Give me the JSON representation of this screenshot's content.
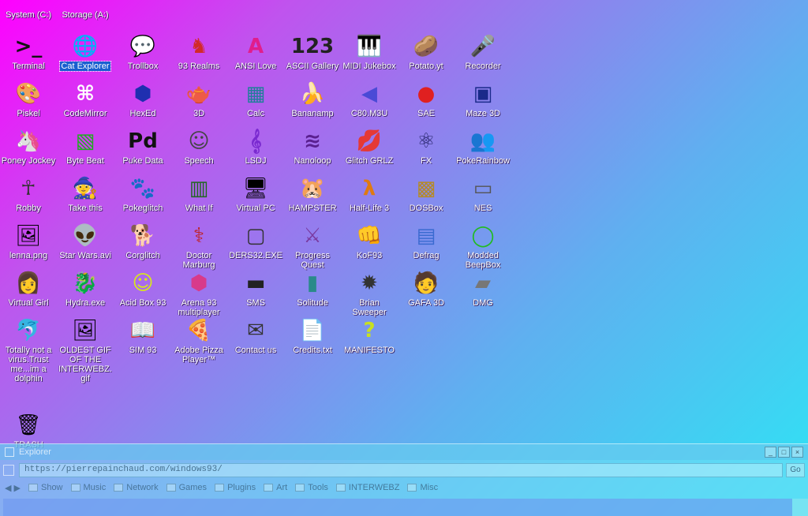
{
  "desktop": {
    "top_row": [
      {
        "label": "System (C:)",
        "icon": "drive-icon"
      },
      {
        "label": "Storage (A:)",
        "icon": "floppy-icon"
      }
    ],
    "rows": [
      [
        {
          "label": "Terminal",
          "glyph": ">_",
          "icon": "terminal-icon",
          "color": "#111111"
        },
        {
          "label": "Cat Explorer",
          "glyph": "🌐",
          "icon": "cat-globe-icon",
          "selected": true
        },
        {
          "label": "Trollbox",
          "glyph": "💬",
          "icon": "chat-bubble-icon"
        },
        {
          "label": "93 Realms",
          "glyph": "♞",
          "icon": "realms-icon",
          "color": "#d22a2a"
        },
        {
          "label": "ANSI Love",
          "glyph": "A",
          "icon": "ansi-icon",
          "color": "#e01e8c"
        },
        {
          "label": "ASCII Gallery",
          "glyph": "123",
          "icon": "ascii-icon",
          "color": "#222222"
        },
        {
          "label": "MIDI Jukebox",
          "glyph": "🎹",
          "icon": "keyboard-icon"
        },
        {
          "label": "Potato.yt",
          "glyph": "🥔",
          "icon": "potato-icon"
        },
        {
          "label": "Recorder",
          "glyph": "🎤",
          "icon": "microphone-icon"
        }
      ],
      [
        {
          "label": "Piskel",
          "glyph": "🎨",
          "icon": "palette-icon"
        },
        {
          "label": "CodeMirror",
          "glyph": "⌘",
          "icon": "codemirror-icon",
          "color": "#ffffff"
        },
        {
          "label": "HexEd",
          "glyph": "⬢",
          "icon": "hexed-cube-icon",
          "color": "#1f2fb0"
        },
        {
          "label": "3D",
          "glyph": "🫖",
          "icon": "teapot-icon"
        },
        {
          "label": "Calc",
          "glyph": "▦",
          "icon": "calculator-icon",
          "color": "#1f7f9a"
        },
        {
          "label": "Bananamp",
          "glyph": "🍌",
          "icon": "banana-icon"
        },
        {
          "label": "C80.M3U",
          "glyph": "◀",
          "icon": "playlist-icon",
          "color": "#4a4ad6"
        },
        {
          "label": "SAE",
          "glyph": "●",
          "icon": "amiga-ball-icon",
          "color": "#e02020"
        },
        {
          "label": "Maze 3D",
          "glyph": "▣",
          "icon": "maze-icon",
          "color": "#1a2a8a"
        }
      ],
      [
        {
          "label": "Poney Jockey",
          "glyph": "🦄",
          "icon": "pony-icon"
        },
        {
          "label": "Byte Beat",
          "glyph": "▧",
          "icon": "bytebeat-icon",
          "color": "#22aa22"
        },
        {
          "label": "Puke Data",
          "glyph": "Pd",
          "icon": "puredata-icon",
          "color": "#111111"
        },
        {
          "label": "Speech",
          "glyph": "☺",
          "icon": "speech-face-icon",
          "color": "#444444"
        },
        {
          "label": "LSDJ",
          "glyph": "𝄞",
          "icon": "lsdj-icon",
          "color": "#7a2ad0"
        },
        {
          "label": "Nanoloop",
          "glyph": "≋",
          "icon": "nanoloop-icon",
          "color": "#5a2090"
        },
        {
          "label": "Glitch GRLZ",
          "glyph": "💋",
          "icon": "lips-icon"
        },
        {
          "label": "FX",
          "glyph": "⚛",
          "icon": "atom-icon",
          "color": "#222266"
        },
        {
          "label": "PokeRainbow",
          "glyph": "👥",
          "icon": "pokerainbow-icon"
        }
      ],
      [
        {
          "label": "Robby",
          "glyph": "☥",
          "icon": "robby-stickman-icon",
          "color": "#333333"
        },
        {
          "label": "Take this",
          "glyph": "🧙",
          "icon": "take-this-icon"
        },
        {
          "label": "Pokeglitch",
          "glyph": "🐾",
          "icon": "pokeglitch-icon"
        },
        {
          "label": "What If",
          "glyph": "▥",
          "icon": "whatif-icon",
          "color": "#226622"
        },
        {
          "label": "Virtual PC",
          "glyph": "🖥",
          "icon": "virtual-pc-icon"
        },
        {
          "label": "HAMPSTER",
          "glyph": "🐹",
          "icon": "hamster-icon"
        },
        {
          "label": "Half-Life 3",
          "glyph": "λ",
          "icon": "half-life-icon",
          "color": "#e07a10"
        },
        {
          "label": "DOSBox",
          "glyph": "▩",
          "icon": "dosbox-icon",
          "color": "#b48a2a"
        },
        {
          "label": "NES",
          "glyph": "▭",
          "icon": "nes-console-icon",
          "color": "#555555"
        }
      ],
      [
        {
          "label": "lenna.png",
          "glyph": "🖼",
          "icon": "image-file-icon"
        },
        {
          "label": "Star Wars.avi",
          "glyph": "👽",
          "icon": "yoda-icon"
        },
        {
          "label": "Corglitch",
          "glyph": "🐕",
          "icon": "corgi-icon"
        },
        {
          "label": "Doctor Marburg",
          "glyph": "⚕",
          "icon": "doctor-icon",
          "color": "#c02020"
        },
        {
          "label": "DERS32.EXE",
          "glyph": "▢",
          "icon": "ders-monitor-icon",
          "color": "#333333"
        },
        {
          "label": "Progress Quest",
          "glyph": "⚔",
          "icon": "crossed-swords-icon",
          "color": "#7a3aa0"
        },
        {
          "label": "KoF93",
          "glyph": "👊",
          "icon": "kof-fighter-icon"
        },
        {
          "label": "Defrag",
          "glyph": "▤",
          "icon": "defrag-icon",
          "color": "#3a6ad0"
        },
        {
          "label": "Modded BeepBox",
          "glyph": "◯",
          "icon": "beepbox-ring-icon",
          "color": "#22bb22"
        }
      ],
      [
        {
          "label": "Virtual Girl",
          "glyph": "👩",
          "icon": "virtual-girl-icon"
        },
        {
          "label": "Hydra.exe",
          "glyph": "🐉",
          "icon": "hydra-dragon-icon"
        },
        {
          "label": "Acid Box 93",
          "glyph": "☺",
          "icon": "acid-smiley-icon",
          "color": "#d8e81a"
        },
        {
          "label": "Arena 93 multiplayer",
          "glyph": "⬢",
          "icon": "arena-cube-icon",
          "color": "#d83a8a"
        },
        {
          "label": "SMS",
          "glyph": "▬",
          "icon": "sms-console-icon",
          "color": "#222222"
        },
        {
          "label": "Solitude",
          "glyph": "▮",
          "icon": "solitude-icon",
          "color": "#2a8a8a"
        },
        {
          "label": "Brian Sweeper",
          "glyph": "✹",
          "icon": "mine-icon",
          "color": "#333333"
        },
        {
          "label": "GAFA 3D",
          "glyph": "🧑",
          "icon": "gafa-face-icon"
        },
        {
          "label": "DMG",
          "glyph": "▰",
          "icon": "dmg-drive-icon",
          "color": "#777777"
        }
      ],
      [
        {
          "label": "Totally not a virus.Trust me...im a dolphin",
          "glyph": "🐬",
          "icon": "dolphin-icon"
        },
        {
          "label": "OLDEST GIF OF THE INTERWEBZ.gif",
          "glyph": "🖼",
          "icon": "gif-file-icon"
        },
        {
          "label": "SIM 93",
          "glyph": "📖",
          "icon": "sim-book-icon"
        },
        {
          "label": "Adobe Pizza Player™",
          "glyph": "🍕",
          "icon": "pizza-icon"
        },
        {
          "label": "Contact us",
          "glyph": "✉",
          "icon": "contact-mail-icon",
          "color": "#333333"
        },
        {
          "label": "Credits.txt",
          "glyph": "📄",
          "icon": "text-file-icon"
        },
        {
          "label": "MANIFESTO",
          "glyph": "?",
          "icon": "question-mark-icon",
          "color": "#c8e020"
        }
      ]
    ],
    "trash": {
      "label": "TRASH",
      "glyph": "🗑",
      "icon": "trash-icon"
    }
  },
  "browser": {
    "title": "Explorer",
    "address": "https://pierrepainchaud.com/windows93/",
    "go_label": "Go",
    "nav_label": "◀ ▶",
    "bookmarks": [
      "Show",
      "Music",
      "Network",
      "Games",
      "Plugins",
      "Art",
      "Tools",
      "INTERWEBZ",
      "Misc"
    ]
  }
}
